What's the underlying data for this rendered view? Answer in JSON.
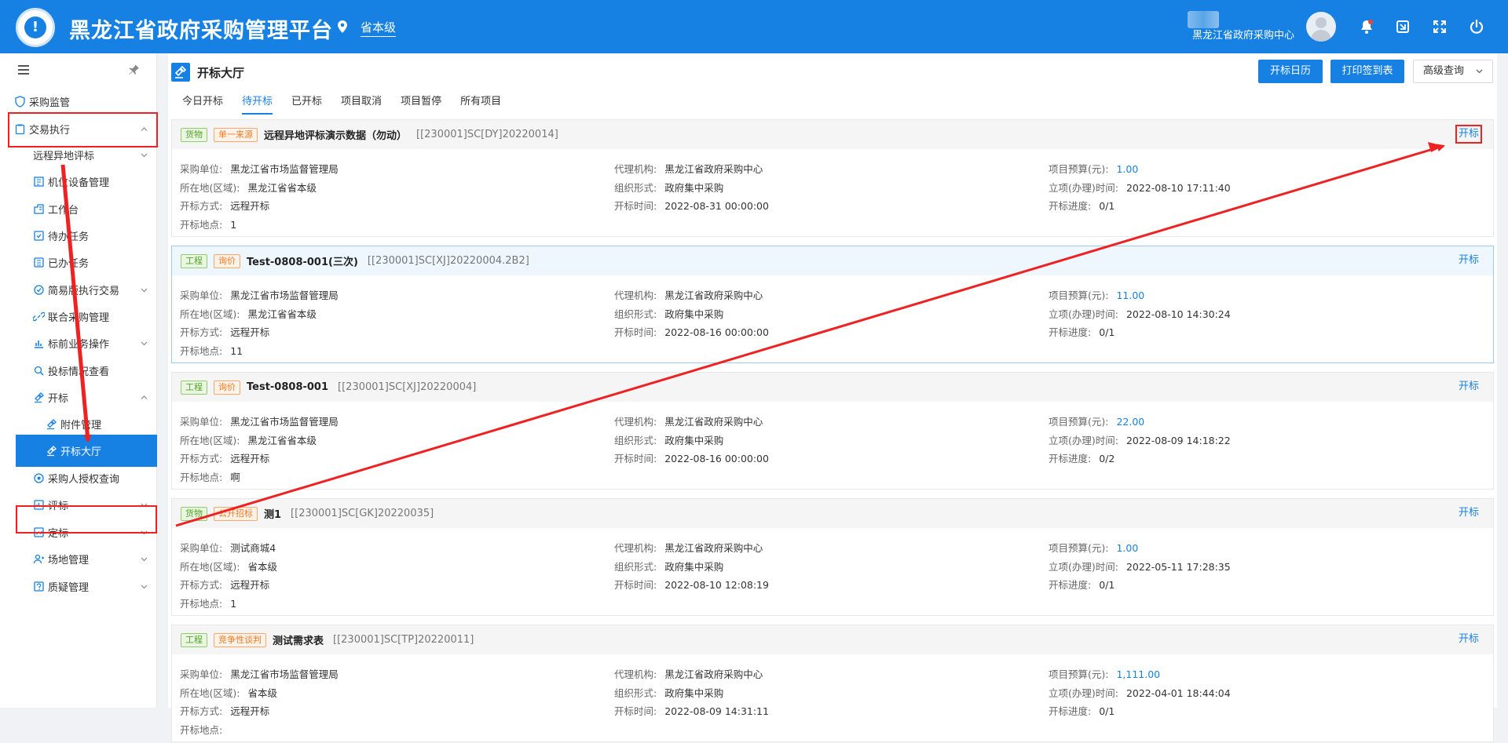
{
  "header": {
    "title": "黑龙江省政府采购管理平台",
    "location": "省本级",
    "user_org": "黑龙江省政府采购中心"
  },
  "sidebar": {
    "items": [
      {
        "label": "采购监管",
        "icon": "shield-icon"
      },
      {
        "label": "交易执行",
        "icon": "clipboard-icon"
      },
      {
        "label": "远程异地评标"
      },
      {
        "label": "机位设备管理",
        "icon": "device-icon"
      },
      {
        "label": "工作台",
        "icon": "building-icon"
      },
      {
        "label": "待办任务",
        "icon": "task-icon"
      },
      {
        "label": "已办任务",
        "icon": "done-icon"
      },
      {
        "label": "简易版执行交易",
        "icon": "cycle-icon"
      },
      {
        "label": "联合采购管理",
        "icon": "link-icon"
      },
      {
        "label": "标前业务操作",
        "icon": "chart-icon"
      },
      {
        "label": "投标情况查看",
        "icon": "view-icon"
      },
      {
        "label": "开标",
        "icon": "hammer-icon"
      },
      {
        "label": "附件管理",
        "icon": "hammer-icon"
      },
      {
        "label": "开标大厅",
        "icon": "hammer-icon"
      },
      {
        "label": "采购人授权查询",
        "icon": "auth-icon"
      },
      {
        "label": "评标",
        "icon": "score-icon"
      },
      {
        "label": "定标",
        "icon": "decide-icon"
      },
      {
        "label": "场地管理",
        "icon": "venue-icon"
      },
      {
        "label": "质疑管理",
        "icon": "question-icon"
      }
    ]
  },
  "page": {
    "title": "开标大厅",
    "buttons": {
      "calendar": "开标日历",
      "print": "打印签到表",
      "advanced": "高级查询"
    },
    "tabs": [
      "今日开标",
      "待开标",
      "已开标",
      "项目取消",
      "项目暂停",
      "所有项目"
    ],
    "active_tab": "待开标"
  },
  "labels": {
    "purchaser": "采购单位:",
    "region": "所在地(区域):",
    "open_method": "开标方式:",
    "open_place": "开标地点:",
    "agency": "代理机构:",
    "org_form": "组织形式:",
    "open_time": "开标时间:",
    "budget": "项目预算(元):",
    "setup_time": "立项(办理)时间:",
    "progress": "开标进度:",
    "open_action": "开标"
  },
  "cards": [
    {
      "tags": [
        {
          "text": "货物",
          "color": "green"
        },
        {
          "text": "单一来源",
          "color": "orange"
        }
      ],
      "title": "远程异地评标演示数据（勿动）",
      "code": "[[230001]SC[DY]20220014]",
      "purchaser": "黑龙江省市场监督管理局",
      "region": "黑龙江省省本级",
      "open_method": "远程开标",
      "open_place": "1",
      "agency": "黑龙江省政府采购中心",
      "org_form": "政府集中采购",
      "open_time": "2022-08-31 00:00:00",
      "budget": "1.00",
      "setup_time": "2022-08-10 17:11:40",
      "progress": "0/1"
    },
    {
      "tags": [
        {
          "text": "工程",
          "color": "green"
        },
        {
          "text": "询价",
          "color": "orange"
        }
      ],
      "title": "Test-0808-001(三次)",
      "code": "[[230001]SC[XJ]20220004.2B2]",
      "purchaser": "黑龙江省市场监督管理局",
      "region": "黑龙江省省本级",
      "open_method": "远程开标",
      "open_place": "11",
      "agency": "黑龙江省政府采购中心",
      "org_form": "政府集中采购",
      "open_time": "2022-08-16 00:00:00",
      "budget": "11.00",
      "setup_time": "2022-08-10 14:30:24",
      "progress": "0/1"
    },
    {
      "tags": [
        {
          "text": "工程",
          "color": "green"
        },
        {
          "text": "询价",
          "color": "orange"
        }
      ],
      "title": "Test-0808-001",
      "code": "[[230001]SC[XJ]20220004]",
      "purchaser": "黑龙江省市场监督管理局",
      "region": "黑龙江省省本级",
      "open_method": "远程开标",
      "open_place": "啊",
      "agency": "黑龙江省政府采购中心",
      "org_form": "政府集中采购",
      "open_time": "2022-08-16 00:00:00",
      "budget": "22.00",
      "setup_time": "2022-08-09 14:18:22",
      "progress": "0/2"
    },
    {
      "tags": [
        {
          "text": "货物",
          "color": "green"
        },
        {
          "text": "公开招标",
          "color": "orange"
        }
      ],
      "title": "测1",
      "code": "[[230001]SC[GK]20220035]",
      "purchaser": "测试商城4",
      "region": "省本级",
      "open_method": "远程开标",
      "open_place": "1",
      "agency": "黑龙江省政府采购中心",
      "org_form": "政府集中采购",
      "open_time": "2022-08-10 12:08:19",
      "budget": "1.00",
      "setup_time": "2022-05-11 17:28:35",
      "progress": "0/1"
    },
    {
      "tags": [
        {
          "text": "工程",
          "color": "green"
        },
        {
          "text": "竞争性谈判",
          "color": "orange"
        }
      ],
      "title": "测试需求表",
      "code": "[[230001]SC[TP]20220011]",
      "purchaser": "黑龙江省市场监督管理局",
      "region": "省本级",
      "open_method": "远程开标",
      "open_place": "",
      "agency": "黑龙江省政府采购中心",
      "org_form": "政府集中采购",
      "open_time": "2022-08-09 14:31:11",
      "budget": "1,111.00",
      "setup_time": "2022-04-01 18:44:04",
      "progress": "0/1"
    }
  ]
}
